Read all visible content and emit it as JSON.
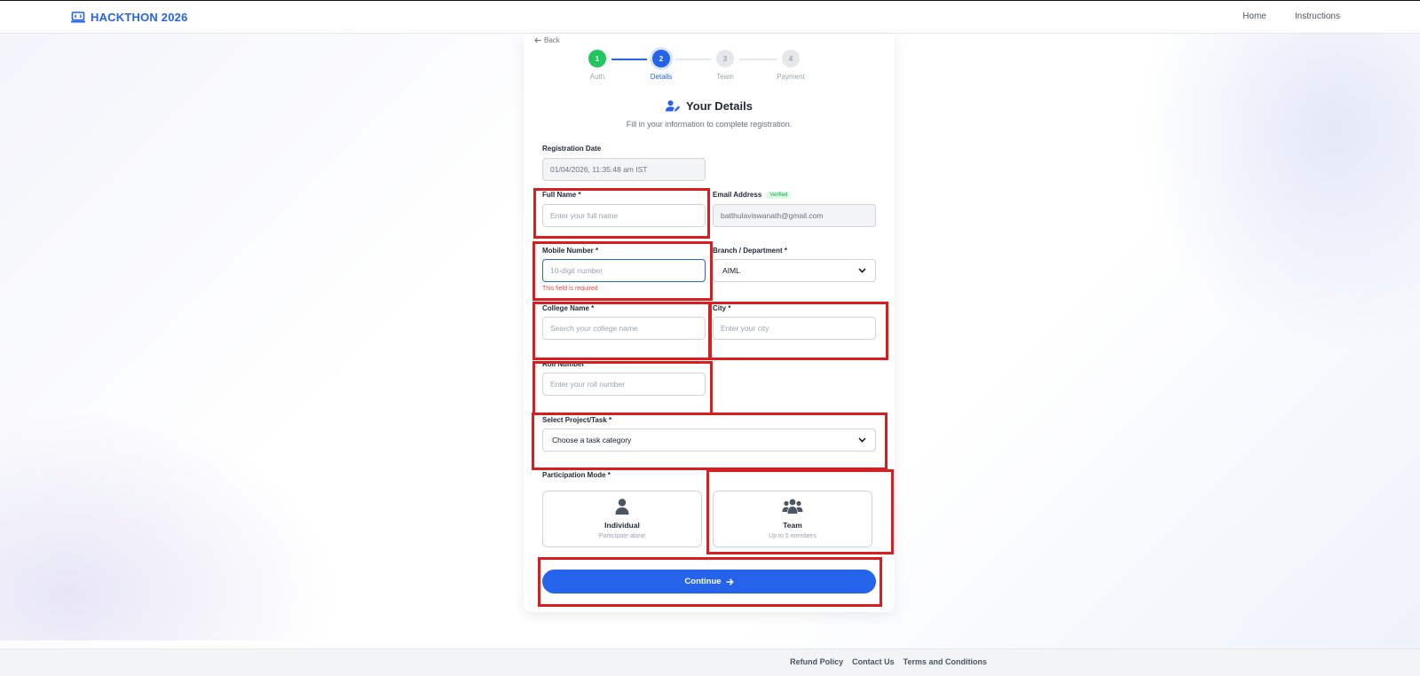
{
  "brand": {
    "name": "HACKTHON 2026",
    "icon": "laptop-code-icon",
    "color": "#2563eb"
  },
  "nav": {
    "home": "Home",
    "instructions": "Instructions"
  },
  "back": {
    "label": "Back",
    "icon": "arrow-left-icon"
  },
  "steps": [
    {
      "num": "1",
      "label": "Auth",
      "state": "done"
    },
    {
      "num": "2",
      "label": "Details",
      "state": "active"
    },
    {
      "num": "3",
      "label": "Team",
      "state": "todo"
    },
    {
      "num": "4",
      "label": "Payment",
      "state": "todo"
    }
  ],
  "form": {
    "title": "Your Details",
    "title_icon": "user-edit-icon",
    "subtitle": "Fill in your information to complete registration.",
    "registration_date": {
      "label": "Registration Date",
      "value": "01/04/2026, 11:35:48 am IST"
    },
    "full_name": {
      "label": "Full Name *",
      "placeholder": "Enter your full name"
    },
    "email": {
      "label": "Email Address",
      "badge": "Verified",
      "value": "batthulaviswanath@gmail.com"
    },
    "mobile": {
      "label": "Mobile Number *",
      "placeholder": "10-digit number",
      "error": "This field is required"
    },
    "branch": {
      "label": "Branch / Department *",
      "value": "AIML"
    },
    "college": {
      "label": "College Name *",
      "placeholder": "Search your college name"
    },
    "city": {
      "label": "City *",
      "placeholder": "Enter your city"
    },
    "roll": {
      "label": "Roll Number *",
      "placeholder": "Enter your roll number"
    },
    "project": {
      "label": "Select Project/Task *",
      "value": "Choose a task category"
    },
    "participation": {
      "label": "Participation Mode *",
      "individual": {
        "title": "Individual",
        "subtitle": "Participate alone",
        "icon": "user-icon"
      },
      "team": {
        "title": "Team",
        "subtitle": "Up to 5 members",
        "icon": "users-icon"
      }
    },
    "continue_label": "Continue"
  },
  "footer": {
    "refund": "Refund Policy",
    "contact": "Contact Us",
    "terms": "Terms and Conditions"
  },
  "colors": {
    "accent": "#2563eb",
    "success": "#22c55e",
    "error": "#ef4444",
    "highlight": "#d81e1e"
  }
}
